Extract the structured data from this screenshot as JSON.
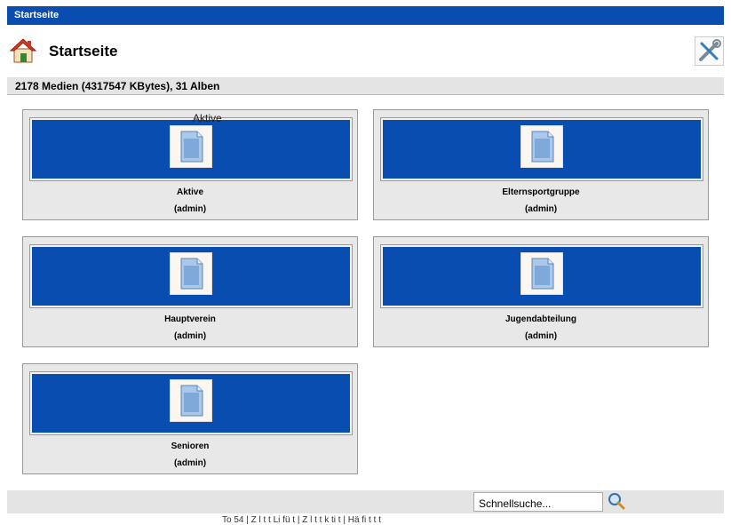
{
  "topbar": {
    "title": "Startseite"
  },
  "header": {
    "title": "Startseite",
    "home_icon": "home-icon",
    "settings_icon": "tools-icon"
  },
  "stats": {
    "text": "2178 Medien (4317547 KBytes), 31 Alben"
  },
  "tooltip": {
    "text": "Aktive"
  },
  "albums": [
    {
      "name": "Aktive",
      "owner": "(admin)"
    },
    {
      "name": "Elternsportgruppe",
      "owner": "(admin)"
    },
    {
      "name": "Hauptverein",
      "owner": "(admin)"
    },
    {
      "name": "Jugendabteilung",
      "owner": "(admin)"
    },
    {
      "name": "Senioren",
      "owner": "(admin)"
    }
  ],
  "search": {
    "value": "Schnellsuche...",
    "icon": "magnifier-icon"
  },
  "footer": {
    "partial_text": "To  54 | Z l t t Li     fü t | Z l t t k      ti t | Hä fi   t    t t"
  },
  "colors": {
    "accent": "#0a4db0",
    "bar": "#e4e4e4"
  }
}
